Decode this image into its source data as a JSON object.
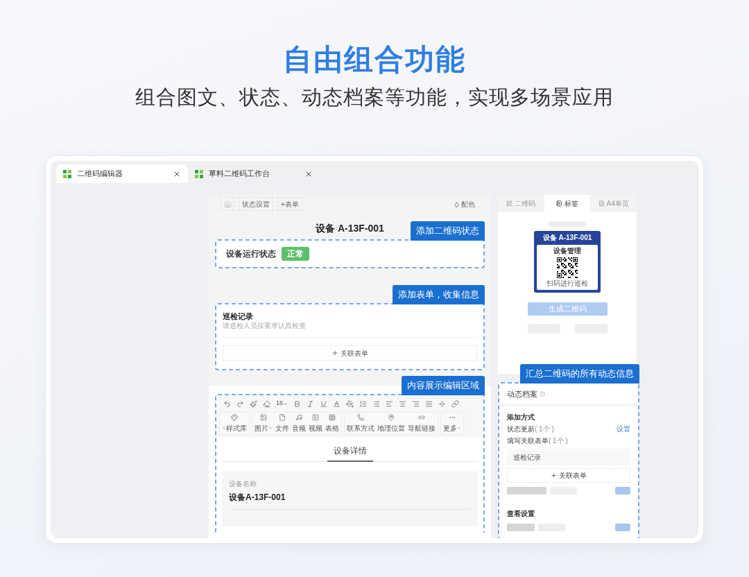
{
  "hero": {
    "title": "自由组合功能",
    "subtitle": "组合图文、状态、动态档案等功能，实现多场景应用"
  },
  "tabs": [
    {
      "label": "二维码编辑器",
      "selected": true
    },
    {
      "label": "草料二维码工作台",
      "selected": false
    }
  ],
  "editor": {
    "toolbar_buttons": [
      {
        "kind": "home"
      },
      {
        "kind": "text",
        "label": "状态设置"
      },
      {
        "kind": "text",
        "label": "+表单"
      }
    ],
    "color_button": "配色",
    "title": "设备 A-13F-001",
    "status_block": {
      "callout": "添加二维码状态",
      "label": "设备运行状态",
      "status": {
        "text": "正常",
        "color": "#5cbf6a"
      }
    },
    "form_block": {
      "callout": "添加表单，收集信息",
      "title": "巡检记录",
      "description": "请巡检人员按要求认真检查",
      "link_button": "关联表单"
    },
    "content_block": {
      "callout": "内容展示编辑区域",
      "font_size": "16",
      "insert_groups": [
        [
          {
            "label": "样式库",
            "dropdown": false,
            "back": true
          }
        ],
        [
          {
            "label": "图片",
            "dropdown": true,
            "back": false
          },
          {
            "label": "文件",
            "dropdown": false,
            "back": false
          },
          {
            "label": "音频",
            "dropdown": false,
            "back": false
          },
          {
            "label": "视频",
            "dropdown": false,
            "back": false
          },
          {
            "label": "表格",
            "dropdown": false,
            "back": false
          }
        ],
        [
          {
            "label": "联系方式",
            "dropdown": false,
            "back": false
          },
          {
            "label": "地理位置",
            "dropdown": false,
            "back": false
          },
          {
            "label": "导航链接",
            "dropdown": false,
            "back": false
          }
        ],
        [
          {
            "label": "更多",
            "dropdown": true,
            "back": false
          }
        ]
      ],
      "section_title": "设备详情",
      "fields": [
        {
          "label": "设备名称",
          "value": "设备A-13F-001"
        }
      ]
    }
  },
  "right_panel": {
    "tabs": [
      {
        "label": "二维码",
        "selected": false
      },
      {
        "label": "标签",
        "selected": true
      },
      {
        "label": "A4单页",
        "selected": false
      }
    ],
    "label_card": {
      "title": "设备 A-13F-001",
      "subtitle": "设备管理",
      "caption": "扫码进行巡检"
    },
    "generate_button": "生成二维码",
    "archive": {
      "callout": "汇总二维码的所有动态信息",
      "title": "动态档案",
      "add_heading": "添加方式",
      "rows": [
        {
          "label": "状态更新",
          "count": "( 1个 )",
          "action": "设置"
        },
        {
          "label": "填写关联表单",
          "count": "( 1个 )"
        }
      ],
      "linked_form": "巡检记录",
      "link_button": "关联表单",
      "view_heading": "查看设置"
    }
  }
}
